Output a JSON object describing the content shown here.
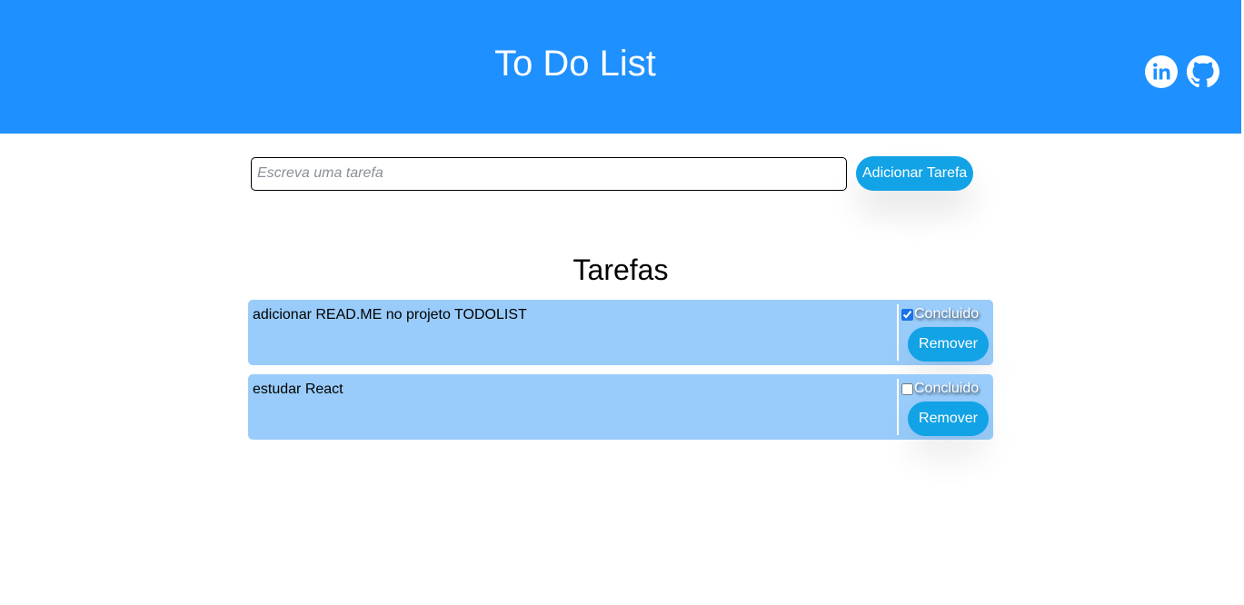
{
  "header": {
    "title": "To Do List",
    "background_color": "#1e90ff",
    "social": [
      {
        "name": "linkedin",
        "icon": "linkedin-icon"
      },
      {
        "name": "github",
        "icon": "github-icon"
      }
    ]
  },
  "add_task": {
    "placeholder": "Escreva uma tarefa",
    "value": "",
    "button_label": "Adicionar Tarefa"
  },
  "tasks_section": {
    "title": "Tarefas",
    "item_color": "#99ccfb",
    "button_color": "#12a2e6",
    "items": [
      {
        "text": "adicionar READ.ME no projeto TODOLIST",
        "done": true,
        "done_label": "Concluido",
        "remove_label": "Remover"
      },
      {
        "text": "estudar React",
        "done": false,
        "done_label": "Concluido",
        "remove_label": "Remover"
      }
    ]
  }
}
